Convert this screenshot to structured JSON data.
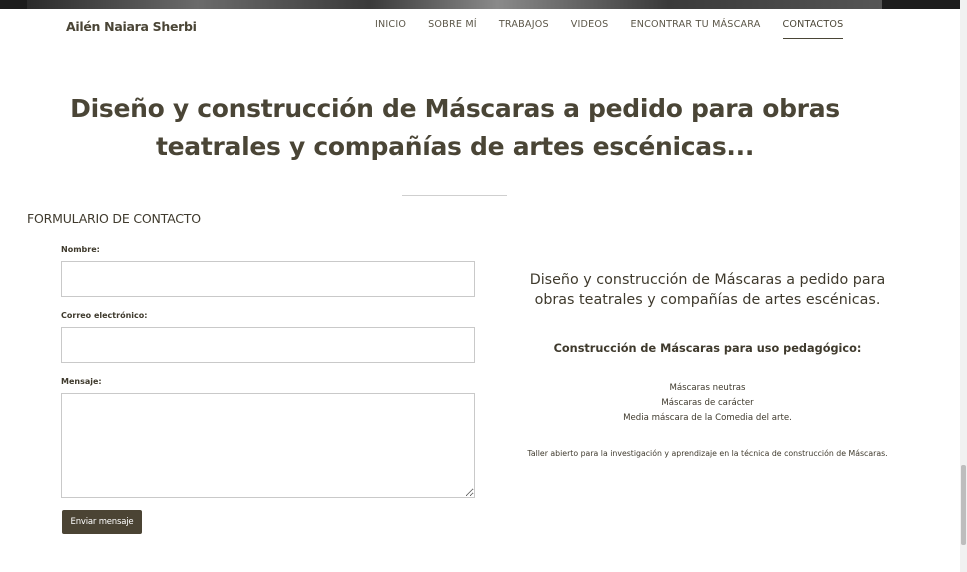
{
  "header": {
    "brand": "Ailén Naiara Sherbi",
    "nav": [
      {
        "label": "INICIO"
      },
      {
        "label": "SOBRE MÍ"
      },
      {
        "label": "TRABAJOS"
      },
      {
        "label": "VIDEOS"
      },
      {
        "label": "ENCONTRAR TU MÁSCARA"
      },
      {
        "label": "CONTACTOS",
        "active": true
      }
    ]
  },
  "hero": {
    "title_line1": "Diseño y construcción de Máscaras a pedido para obras",
    "title_line2": "teatrales y compañías de artes escénicas..."
  },
  "form": {
    "heading": "FORMULARIO DE CONTACTO",
    "name_label": "Nombre:",
    "name_value": "",
    "email_label": "Correo electrónico:",
    "email_value": "",
    "message_label": "Mensaje:",
    "message_value": "",
    "submit_label": "Enviar mensaje"
  },
  "side": {
    "title_line1": "Diseño y construcción de Máscaras a pedido para",
    "title_line2": "obras teatrales y compañías de artes escénicas.",
    "subtitle": "Construcción de Máscaras para uso pedagógico:",
    "items": [
      "Máscaras neutras",
      "Máscaras de carácter",
      "Media máscara de la Comedia del arte."
    ],
    "note": "Taller abierto para la investigación y aprendizaje en la técnica de construcción de Máscaras."
  },
  "colors": {
    "text": "#4a4536",
    "button_bg": "#4b4434",
    "button_text": "#ffffff"
  }
}
